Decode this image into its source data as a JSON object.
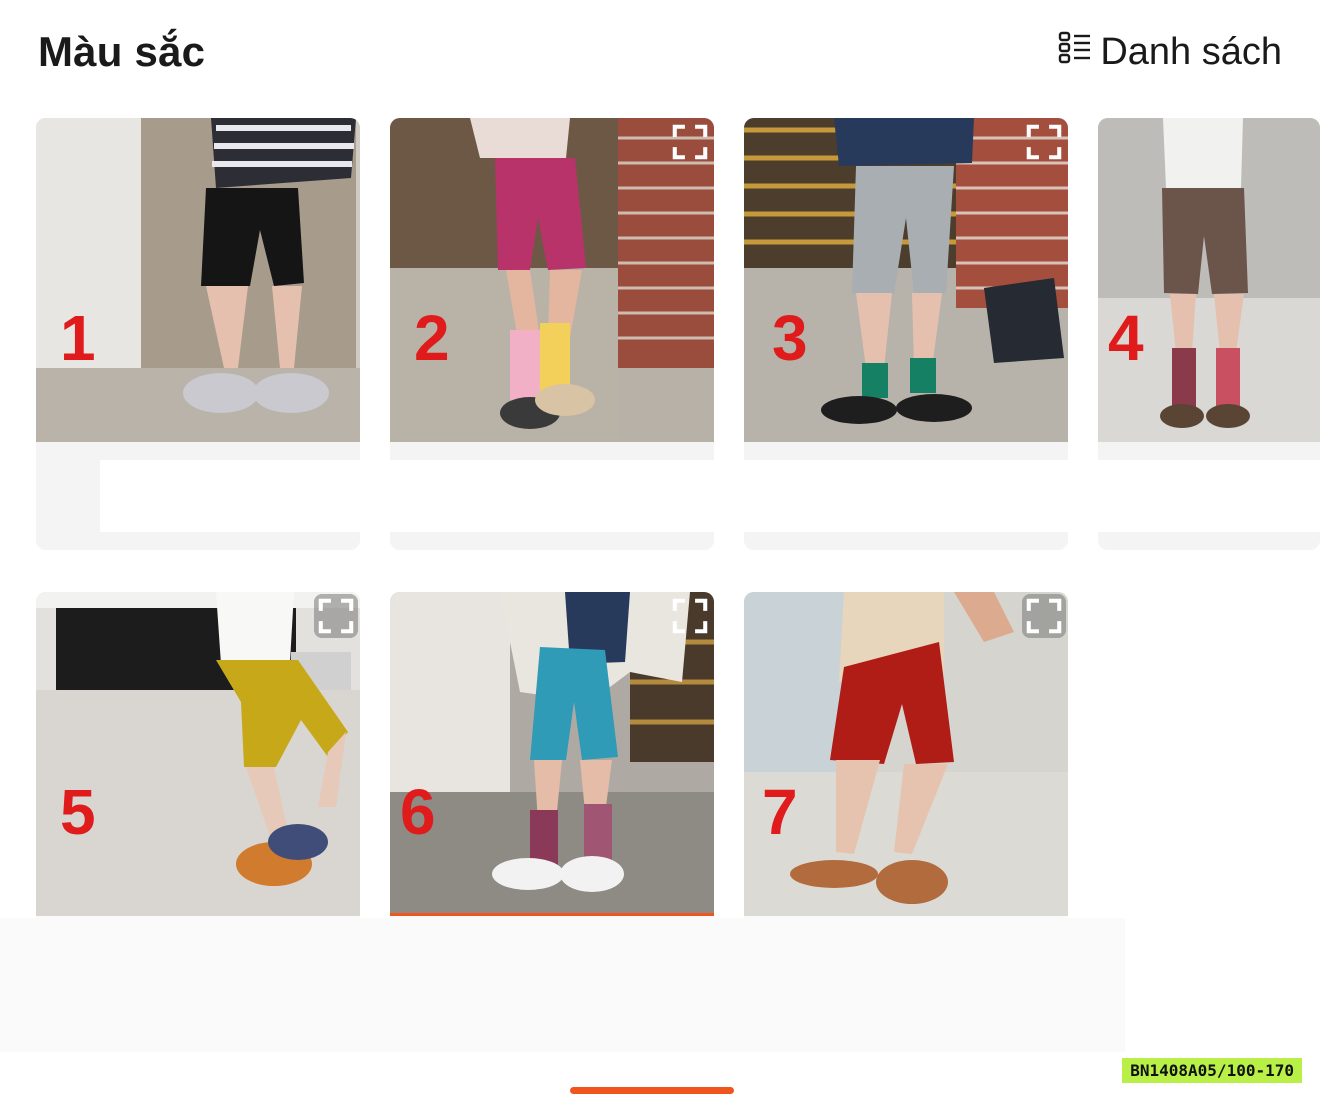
{
  "header": {
    "title": "Màu sắc",
    "view_toggle_label": "Danh sách",
    "view_toggle_icon": "list-view-icon"
  },
  "variants": [
    {
      "number": "1",
      "shorts_color": "#151515"
    },
    {
      "number": "2",
      "shorts_color": "#b8336a"
    },
    {
      "number": "3",
      "shorts_color": "#a8aeb1"
    },
    {
      "number": "4",
      "shorts_color": "#6b544a"
    },
    {
      "number": "5",
      "shorts_color": "#c6a818"
    },
    {
      "number": "6",
      "shorts_color": "#2f9bb6",
      "selected": true
    },
    {
      "number": "7",
      "shorts_color": "#b01c16"
    }
  ],
  "sku": "BN1408A05/100-170",
  "colors": {
    "accent": "#f0551e",
    "number_label": "#e01b1b",
    "sku_background": "#b8f048"
  }
}
